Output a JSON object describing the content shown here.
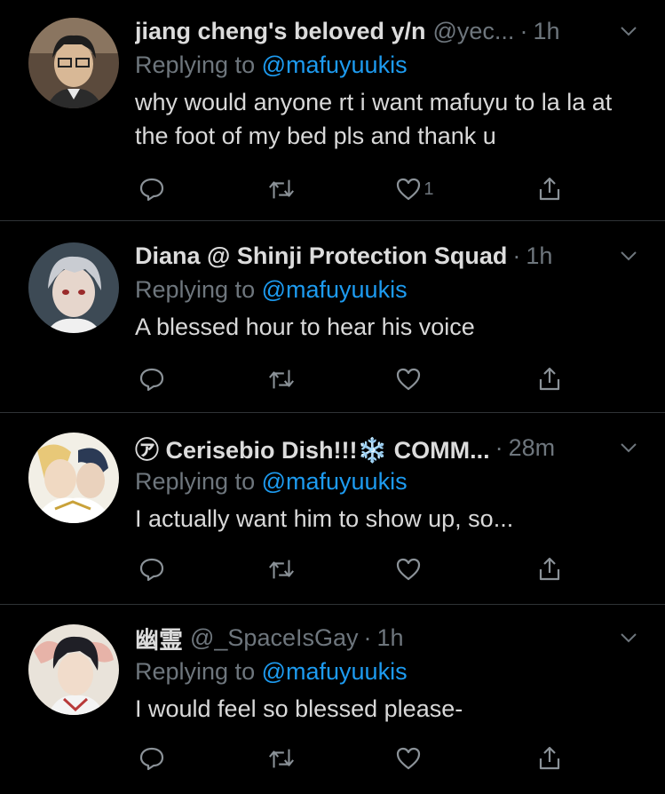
{
  "tweets": [
    {
      "name": "jiang cheng's beloved y/n",
      "handle": "@yec...",
      "time": "1h",
      "reply_prefix": "Replying to",
      "reply_to": "@mafuyuukis",
      "text": "why would anyone rt i want mafuyu to la la at the foot of my bed pls and thank u",
      "like_count": "1"
    },
    {
      "name": "Diana @ Shinji Protection Squad",
      "handle": "",
      "time": "1h",
      "reply_prefix": "Replying to",
      "reply_to": "@mafuyuukis",
      "text": "A blessed hour to hear his voice",
      "like_count": ""
    },
    {
      "name": "㋐ Cerisebio Dish!!!❄️ COMM...",
      "handle": "",
      "time": "28m",
      "reply_prefix": "Replying to",
      "reply_to": "@mafuyuukis",
      "text": "I actually want him to show up, so...",
      "like_count": ""
    },
    {
      "name": "幽霊",
      "handle": "@_SpaceIsGay",
      "time": "1h",
      "reply_prefix": "Replying to",
      "reply_to": "@mafuyuukis",
      "text": "I would feel so blessed please-",
      "like_count": ""
    }
  ],
  "icons": {
    "reply": "reply-icon",
    "retweet": "retweet-icon",
    "like": "heart-icon",
    "share": "share-icon",
    "more": "chevron-down-icon"
  },
  "colors": {
    "background": "#000000",
    "text": "#d9d9d9",
    "muted": "#6e767d",
    "link": "#1d9bf0"
  }
}
